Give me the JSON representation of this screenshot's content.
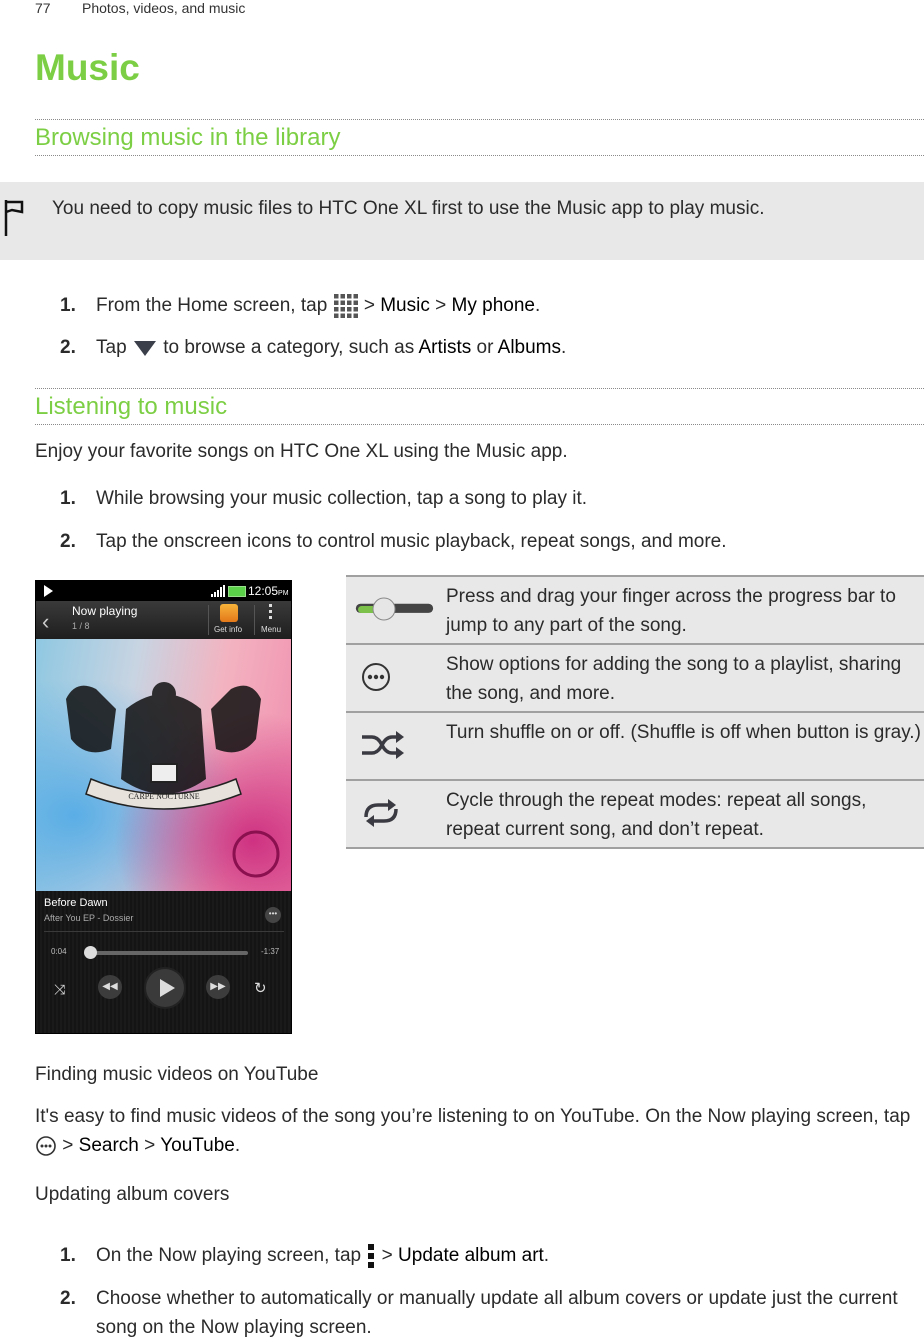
{
  "header": {
    "page_number": "77",
    "chapter": "Photos, videos, and music"
  },
  "title": "Music",
  "sections": {
    "browsing": {
      "heading": "Browsing music in the library",
      "note": "You need to copy music files to HTC One XL first to use the Music app to play music.",
      "steps": [
        {
          "num": "1.",
          "pre": "From the Home screen, tap",
          "icon": "all-apps-grid-icon",
          "post": [
            ">",
            "Music",
            ">",
            "My phone",
            "."
          ]
        },
        {
          "num": "2.",
          "pre": "Tap",
          "icon": "dropdown-triangle-icon",
          "mid": "to browse a category, such as",
          "bold1": "Artists",
          "or": "or",
          "bold2": "Albums",
          "end": "."
        }
      ]
    },
    "listening": {
      "heading": "Listening to music",
      "intro": "Enjoy your favorite songs on HTC One XL using the Music app.",
      "steps": [
        {
          "num": "1.",
          "text": "While browsing your music collection, tap a song to play it."
        },
        {
          "num": "2.",
          "text": "Tap the onscreen icons to control music playback, repeat songs, and more."
        }
      ]
    },
    "phone": {
      "status_time": "12:05",
      "status_ampm": "PM",
      "bar_title": "Now playing",
      "bar_sub": "1 / 8",
      "get_info": "Get info",
      "menu": "Menu",
      "album_motto": "CARPE NOCTURNE",
      "song": "Before Dawn",
      "album": "After You EP - Dossier",
      "elapsed": "0:04",
      "remaining": "-1:37",
      "progress_fraction": 0.03
    },
    "icon_table": [
      {
        "icon": "progress-slider-icon",
        "text": "Press and drag your finger across the progress bar to jump to any part of the song."
      },
      {
        "icon": "more-options-icon",
        "text": "Show options for adding the song to a playlist, sharing the song, and more."
      },
      {
        "icon": "shuffle-icon",
        "text": "Turn shuffle on or off. (Shuffle is off when button is gray.)"
      },
      {
        "icon": "repeat-icon",
        "text": "Cycle through the repeat modes: repeat all songs, repeat current song, and don’t repeat."
      }
    ],
    "youtube": {
      "heading": "Finding music videos on YouTube",
      "text_pre": "It's easy to find music videos of the song you’re listening to on YouTube. On the Now playing screen, tap",
      "gt1": ">",
      "search": "Search",
      "gt2": ">",
      "youtube": "YouTube",
      "end": "."
    },
    "album_covers": {
      "heading": "Updating album covers",
      "steps": [
        {
          "num": "1.",
          "pre": "On the Now playing screen, tap",
          "gt": ">",
          "bold": "Update album art",
          "end": "."
        },
        {
          "num": "2.",
          "text": "Choose whether to automatically or manually update all album covers or update just the current song on the Now playing screen."
        }
      ]
    }
  }
}
